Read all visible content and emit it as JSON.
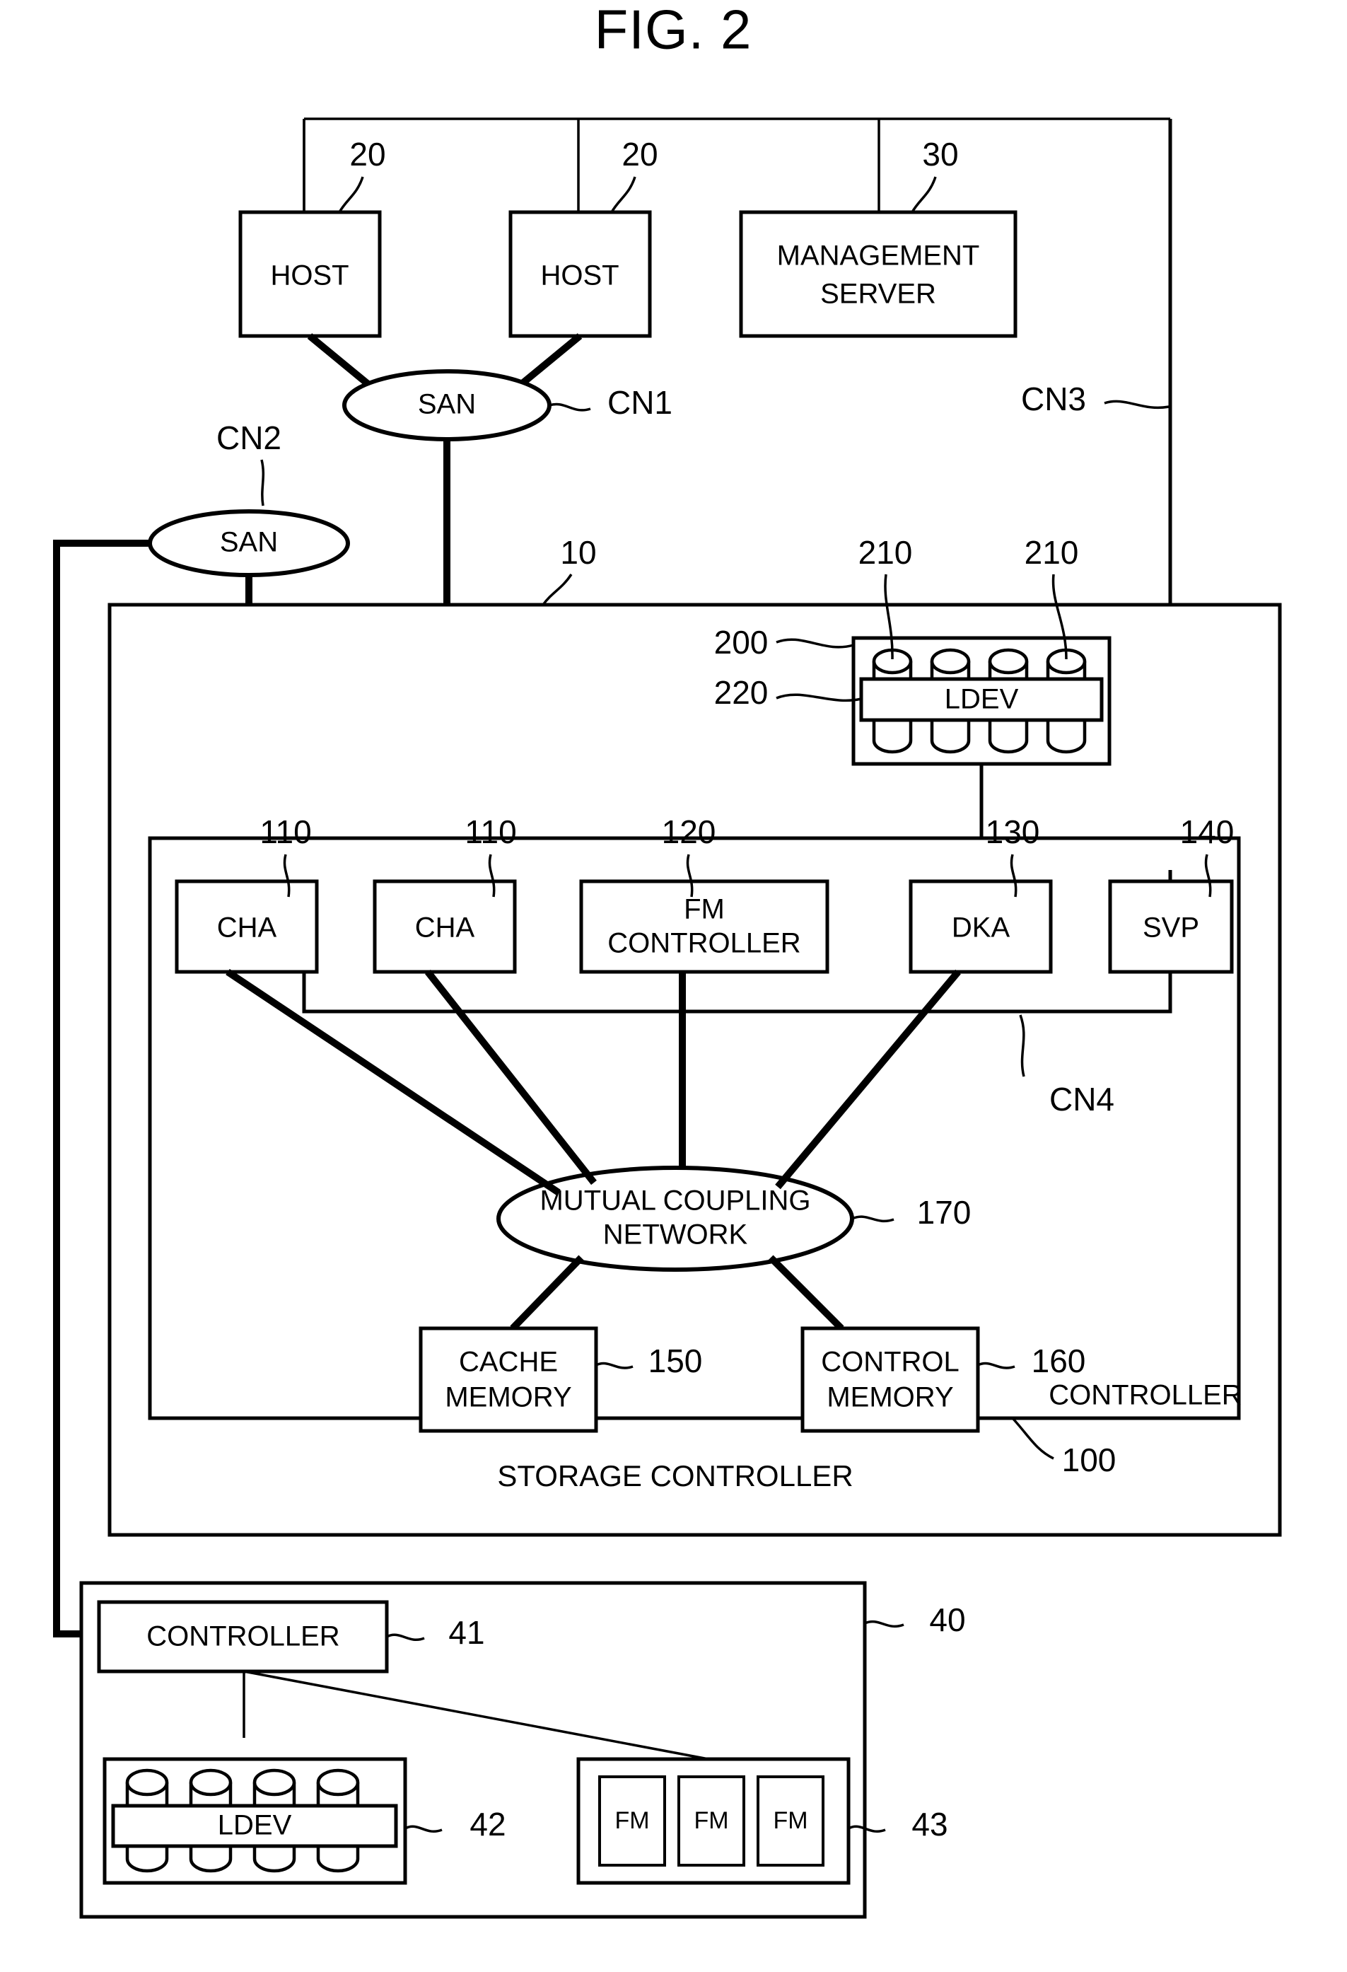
{
  "figure": {
    "title": "FIG. 2",
    "type": "patent-block-diagram"
  },
  "nodes": {
    "host_left": {
      "label": "HOST",
      "ref": "20"
    },
    "host_right": {
      "label": "HOST",
      "ref": "20"
    },
    "management_server": {
      "label_line1": "MANAGEMENT",
      "label_line2": "SERVER",
      "ref": "30"
    },
    "san_top": {
      "label": "SAN"
    },
    "san_left": {
      "label": "SAN"
    },
    "storage_system": {
      "ref": "10"
    },
    "disk_array": {
      "ref_array": "200",
      "ref_ldev": "220",
      "ldev_label": "LDEV",
      "disk_refs": [
        "210",
        "210"
      ],
      "disk_count": 4
    },
    "cha_left": {
      "label": "CHA",
      "ref": "110"
    },
    "cha_right": {
      "label": "CHA",
      "ref": "110"
    },
    "fm_controller": {
      "label_line1": "FM",
      "label_line2": "CONTROLLER",
      "ref": "120"
    },
    "dka": {
      "label": "DKA",
      "ref": "130"
    },
    "svp": {
      "label": "SVP",
      "ref": "140"
    },
    "mutual_coupling_network": {
      "label_line1": "MUTUAL COUPLING",
      "label_line2": "NETWORK",
      "ref": "170"
    },
    "cache_memory": {
      "label_line1": "CACHE",
      "label_line2": "MEMORY",
      "ref": "150"
    },
    "control_memory": {
      "label_line1": "CONTROL",
      "label_line2": "MEMORY",
      "ref": "160"
    },
    "controller_inner": {
      "label": "CONTROLLER",
      "ref": "100"
    },
    "storage_controller": {
      "label": "STORAGE CONTROLLER"
    },
    "external_storage": {
      "ref": "40"
    },
    "external_controller": {
      "label": "CONTROLLER",
      "ref": "41"
    },
    "external_ldev": {
      "label": "LDEV",
      "ref": "42",
      "disk_count": 4
    },
    "external_fm_group": {
      "ref": "43",
      "items": [
        "FM",
        "FM",
        "FM"
      ]
    }
  },
  "connections": {
    "cn1": {
      "label": "CN1"
    },
    "cn2": {
      "label": "CN2"
    },
    "cn3": {
      "label": "CN3"
    },
    "cn4": {
      "label": "CN4"
    }
  },
  "colors": {
    "ink": "#000000",
    "paper": "#ffffff"
  }
}
